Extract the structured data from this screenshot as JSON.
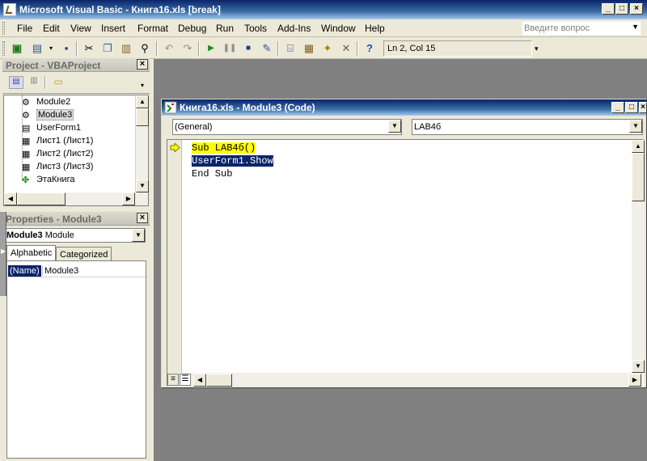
{
  "window": {
    "title": "Microsoft Visual Basic - Книга16.xls [break]",
    "min": "_",
    "max": "□",
    "close": "×"
  },
  "menu": {
    "items": [
      "File",
      "Edit",
      "View",
      "Insert",
      "Format",
      "Debug",
      "Run",
      "Tools",
      "Add-Ins",
      "Window",
      "Help"
    ],
    "ask_placeholder": "Введите вопрос"
  },
  "toolbar": {
    "position": "Ln 2, Col 15"
  },
  "project": {
    "title": "Project - VBAProject",
    "items": [
      "Module2",
      "Module3",
      "UserForm1",
      "Лист1 (Лист1)",
      "Лист2 (Лист2)",
      "Лист3 (Лист3)",
      "ЭтаКнига"
    ]
  },
  "properties": {
    "title": "Properties - Module3",
    "object_name": "Module3",
    "object_type": "Module",
    "tabs": [
      "Alphabetic",
      "Categorized"
    ],
    "row_name": "(Name)",
    "row_value": "Module3"
  },
  "code_window": {
    "title": "Книга16.xls - Module3 (Code)",
    "object_combo": "(General)",
    "proc_combo": "LAB4б",
    "lines": [
      "Sub LAB4б()",
      "UserForm1.Show",
      "End Sub"
    ]
  },
  "colors": {
    "titlebar": "#0a246a",
    "mdi_background": "#808080",
    "execution_highlight": "#ffff00",
    "selection": "#0a246a"
  }
}
